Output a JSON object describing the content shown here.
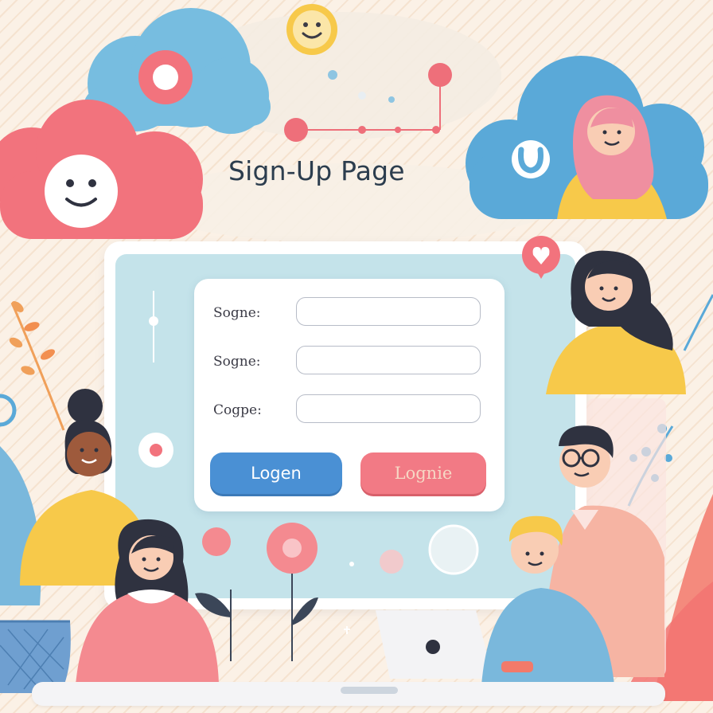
{
  "page": {
    "title": "Sign-Up Page"
  },
  "form": {
    "fields": [
      {
        "label": "Sogne:",
        "value": ""
      },
      {
        "label": "Sogne:",
        "value": ""
      },
      {
        "label": "Cogpe:",
        "value": ""
      }
    ],
    "buttons": {
      "primary_label": "Logen",
      "secondary_label": "Lognie"
    }
  },
  "colors": {
    "primary_button": "#4a90d4",
    "secondary_button": "#f27a85",
    "screen": "#c4e3ea",
    "background": "#fbf1e6"
  },
  "icons": [
    "smiley-icon",
    "heart-icon",
    "ring-icon"
  ]
}
